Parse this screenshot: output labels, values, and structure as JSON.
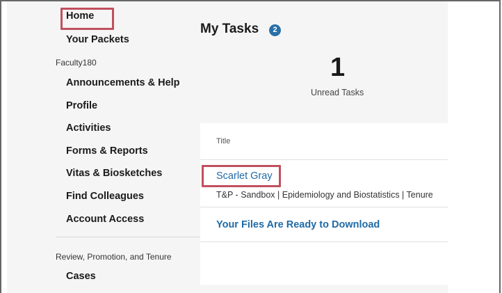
{
  "sidebar": {
    "items_top": [
      {
        "label": "Home"
      },
      {
        "label": "Your Packets"
      }
    ],
    "section1_label": "Faculty180",
    "section1_items": [
      {
        "label": "Announcements & Help"
      },
      {
        "label": "Profile"
      },
      {
        "label": "Activities"
      },
      {
        "label": "Forms & Reports"
      },
      {
        "label": "Vitas & Biosketches"
      },
      {
        "label": "Find Colleagues"
      },
      {
        "label": "Account Access"
      }
    ],
    "section2_label": "Review, Promotion, and Tenure",
    "section2_items": [
      {
        "label": "Cases"
      }
    ]
  },
  "main": {
    "title": "My Tasks",
    "badge_count": "2",
    "unread_count": "1",
    "unread_label": "Unread Tasks",
    "table": {
      "column_title": "Title",
      "rows": [
        {
          "title": "Scarlet Gray",
          "subtitle": "T&P - Sandbox | Epidemiology and Biostatistics | Tenure"
        },
        {
          "title": "Your Files Are Ready to Download"
        }
      ]
    }
  },
  "colors": {
    "highlight": "#c0505f",
    "link": "#1f6aa6",
    "badge": "#2a6fa8",
    "panel_bg": "#f5f5f5"
  }
}
